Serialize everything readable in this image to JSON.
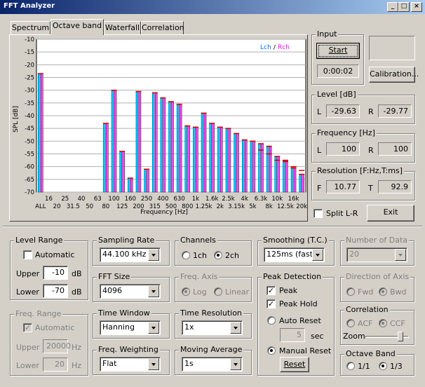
{
  "window": {
    "title": "FFT Analyzer"
  },
  "tabs": [
    {
      "label": "Spectrum",
      "active": false
    },
    {
      "label": "Octave band",
      "active": true
    },
    {
      "label": "Waterfall",
      "active": false
    },
    {
      "label": "Correlation",
      "active": false
    }
  ],
  "chart_data": {
    "type": "bar",
    "ylabel": "SPL [dB]",
    "xlabel": "Frequency [Hz]",
    "ylim": [
      -70,
      -10
    ],
    "yticks": [
      "-10",
      "-15",
      "-20",
      "-25",
      "-30",
      "-35",
      "-40",
      "-45",
      "-50",
      "-55",
      "-60",
      "-65",
      "-70"
    ],
    "legend": {
      "lch": "Lch",
      "sep": " / ",
      "rch": "Rch",
      "position": "top-right"
    },
    "categories": [
      "ALL",
      "16",
      "20",
      "25",
      "31.5",
      "40",
      "50",
      "63",
      "80",
      "100",
      "125",
      "160",
      "200",
      "250",
      "315",
      "400",
      "500",
      "630",
      "800",
      "1k",
      "1.25k",
      "1.6k",
      "2k",
      "2.5k",
      "3.15k",
      "4k",
      "5k",
      "6.3k",
      "8k",
      "10k",
      "12.5k",
      "16k",
      "20k"
    ],
    "tick_labels_top": [
      "16",
      "25",
      "40",
      "63",
      "100",
      "160",
      "250",
      "400",
      "630",
      "1k",
      "1.6k",
      "2.5k",
      "4k",
      "6.3k",
      "10k",
      "16k"
    ],
    "tick_labels_bottom": [
      "ALL",
      "20",
      "31.5",
      "50",
      "80",
      "125",
      "200",
      "315",
      "500",
      "800",
      "1.25k",
      "2k",
      "3.15k",
      "5k",
      "8k",
      "12.5k",
      "20k"
    ],
    "series": [
      {
        "name": "Lch",
        "color": "#00c8ff",
        "values": [
          -23.5,
          null,
          null,
          null,
          null,
          null,
          null,
          null,
          -43,
          -30,
          -54,
          -64.5,
          -30.5,
          -61,
          -31,
          -33,
          -34.5,
          -35.5,
          -44,
          -44.5,
          -39,
          -43,
          -44.5,
          -45,
          -47,
          -49.5,
          -50,
          -51,
          -52,
          -56,
          -57.5,
          -60.5,
          -63
        ]
      },
      {
        "name": "Rch",
        "color": "#ff44ff",
        "values": [
          -23.5,
          null,
          null,
          null,
          null,
          null,
          null,
          null,
          -43,
          -30,
          -54,
          -64.5,
          -30.5,
          -61,
          -31,
          -33,
          -34.5,
          -35.5,
          -44,
          -44.5,
          -39,
          -43,
          -44.5,
          -45,
          -47,
          -49.5,
          -50,
          -51,
          -52,
          -56,
          -57.5,
          -60.5,
          -63
        ]
      }
    ],
    "peak_hold": [
      null,
      null,
      null,
      null,
      null,
      null,
      null,
      null,
      null,
      null,
      null,
      null,
      null,
      null,
      null,
      null,
      null,
      null,
      null,
      null,
      null,
      null,
      null,
      null,
      null,
      null,
      null,
      -53.5,
      -55,
      -57.5,
      -58,
      -60,
      -61.5
    ],
    "grid": true
  },
  "input": {
    "group": "Input",
    "start_label": "Start",
    "elapsed": "0:00:02",
    "calibration_label": "Calibration..."
  },
  "level": {
    "group": "Level [dB]",
    "l_label": "L",
    "l_value": "-29.63",
    "r_label": "R",
    "r_value": "-29.77"
  },
  "frequency": {
    "group": "Frequency [Hz]",
    "l_label": "L",
    "l_value": "100",
    "r_label": "R",
    "r_value": "100"
  },
  "resolution": {
    "group": "Resolution [F:Hz,T:ms]",
    "f_label": "F",
    "f_value": "10.77",
    "t_label": "T",
    "t_value": "92.9"
  },
  "split_lr": {
    "label": "Split L-R",
    "checked": false
  },
  "exit_label": "Exit",
  "level_range": {
    "group": "Level Range",
    "automatic": "Automatic",
    "upper_label": "Upper",
    "upper": "-10",
    "lower_label": "Lower",
    "lower": "-70",
    "unit": "dB"
  },
  "freq_range": {
    "group": "Freq. Range",
    "automatic": "Automatic",
    "upper_label": "Upper",
    "upper": "20000",
    "lower_label": "Lower",
    "lower": "20",
    "unit": "Hz"
  },
  "sampling_rate": {
    "group": "Sampling Rate",
    "value": "44.100 kHz"
  },
  "fft_size": {
    "group": "FFT Size",
    "value": "4096"
  },
  "time_window": {
    "group": "Time Window",
    "value": "Hanning"
  },
  "freq_weighting": {
    "group": "Freq. Weighting",
    "value": "Flat"
  },
  "channels": {
    "group": "Channels",
    "opt1": "1ch",
    "opt2": "2ch"
  },
  "freq_axis": {
    "group": "Freq. Axis",
    "opt1": "Log",
    "opt2": "Linear"
  },
  "time_resolution": {
    "group": "Time Resolution",
    "value": "1x"
  },
  "moving_average": {
    "group": "Moving Average",
    "value": "1s"
  },
  "smoothing": {
    "group": "Smoothing (T.C.)",
    "value": "125ms (fast)"
  },
  "peak_detection": {
    "group": "Peak Detection",
    "peak": "Peak",
    "peak_hold": "Peak Hold",
    "auto_reset": "Auto Reset",
    "seconds": "5",
    "sec_unit": "sec",
    "manual_reset": "Manual Reset",
    "reset_label": "Reset"
  },
  "number_of_data": {
    "group": "Number of Data",
    "value": "20"
  },
  "direction_of_axis": {
    "group": "Direction of Axis",
    "opt1": "Fwd",
    "opt2": "Bwd"
  },
  "correlation": {
    "group": "Correlation",
    "opt1": "ACF",
    "opt2": "CCF",
    "zoom_label": "Zoom"
  },
  "octave_band": {
    "group": "Octave Band",
    "opt1": "1/1",
    "opt2": "1/3"
  }
}
